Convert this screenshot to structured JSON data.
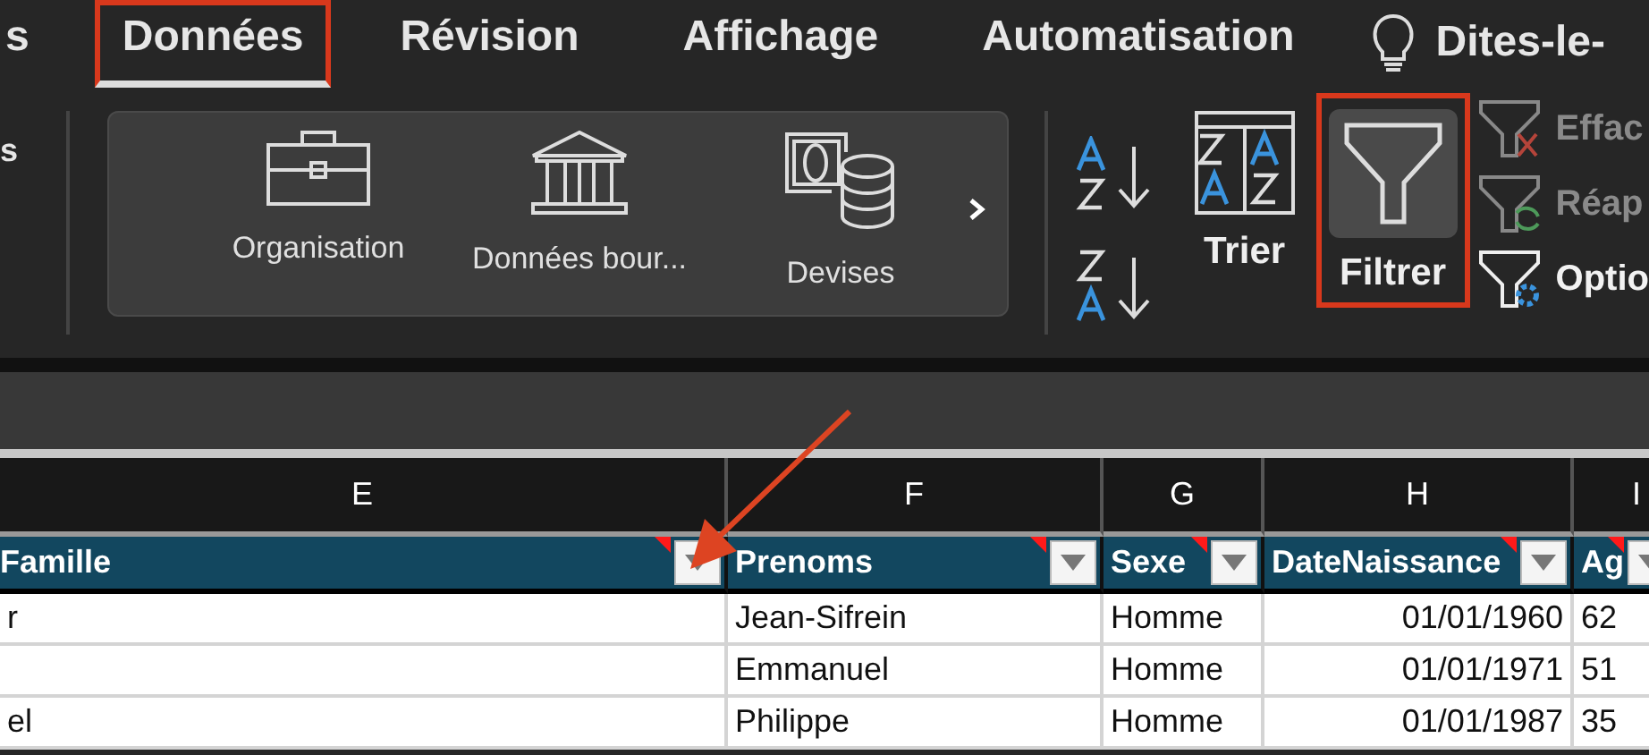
{
  "tabs": [
    {
      "label": "s",
      "selected": false,
      "highlighted": false
    },
    {
      "label": "Données",
      "selected": true,
      "highlighted": true
    },
    {
      "label": "Révision",
      "selected": false,
      "highlighted": false
    },
    {
      "label": "Affichage",
      "selected": false,
      "highlighted": false
    },
    {
      "label": "Automatisation",
      "selected": false,
      "highlighted": false
    }
  ],
  "tell_me": {
    "label": "Dites-le-"
  },
  "ribbon": {
    "left_label": "s",
    "data_types": [
      {
        "kind": "briefcase",
        "label": "Organisation"
      },
      {
        "kind": "bank",
        "label": "Données bour..."
      },
      {
        "kind": "currency",
        "label": "Devises"
      }
    ],
    "sort_buttons": [
      {
        "kind": "az"
      },
      {
        "kind": "za"
      }
    ],
    "sort": {
      "label": "Trier"
    },
    "filter": {
      "label": "Filtrer",
      "highlighted": true
    },
    "filter_commands": [
      {
        "kind": "clear",
        "label": "Effac",
        "disabled": true
      },
      {
        "kind": "reapply",
        "label": "Réap",
        "disabled": true
      },
      {
        "kind": "options",
        "label": "Optio",
        "disabled": false
      }
    ]
  },
  "sheet": {
    "columns": [
      {
        "letter": "E",
        "header": "Famille"
      },
      {
        "letter": "F",
        "header": "Prenoms"
      },
      {
        "letter": "G",
        "header": "Sexe"
      },
      {
        "letter": "H",
        "header": "DateNaissance"
      },
      {
        "letter": "I",
        "header": "Ag"
      }
    ],
    "rows": [
      [
        "r",
        "Jean-Sifrein",
        "Homme",
        "01/01/1960",
        "62"
      ],
      [
        "",
        "Emmanuel",
        "Homme",
        "01/01/1971",
        "51"
      ],
      [
        "el",
        "Philippe",
        "Homme",
        "01/01/1987",
        "35"
      ]
    ]
  }
}
